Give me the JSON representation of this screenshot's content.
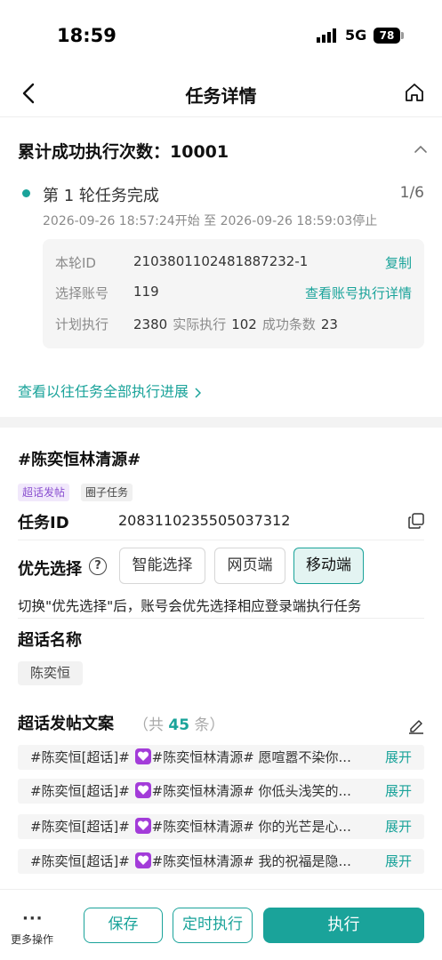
{
  "status_bar": {
    "time": "18:59",
    "network": "5G",
    "battery": "78"
  },
  "nav": {
    "title": "任务详情",
    "back_icon": "chevron-left-icon",
    "home_icon": "home-icon"
  },
  "summary": {
    "title": "累计成功执行次数：10001"
  },
  "round": {
    "title": "第 1 轮任务完成",
    "count": "1/6",
    "time_range": "2026-09-26 18:57:24开始 至 2026-09-26 18:59:03停止",
    "status_color": "#1aa39a"
  },
  "info": {
    "round_id_label": "本轮ID",
    "round_id": "2103801102481887232-1",
    "copy_link": "复制",
    "accounts_label": "选择账号",
    "accounts": "119",
    "accounts_link": "查看账号执行详情",
    "plan_label": "计划执行",
    "plan": "2380",
    "actual_label": "实际执行",
    "actual": "102",
    "success_label": "成功条数",
    "success": "23"
  },
  "history_link": "查看以往任务全部执行进展",
  "task": {
    "name": "#陈奕恒林清源#",
    "tags": [
      "超话发帖",
      "圈子任务"
    ],
    "id_label": "任务ID",
    "id": "2083110235505037312"
  },
  "priority": {
    "label": "优先选择",
    "help": "?",
    "options": [
      "智能选择",
      "网页端",
      "移动端"
    ],
    "selected": "移动端",
    "hint": "切换\"优先选择\"后，账号会优先选择相应登录端执行任务"
  },
  "topic": {
    "label": "超话名称",
    "value": "陈奕恒"
  },
  "copywriting": {
    "label": "超话发帖文案",
    "count_prefix": "（共",
    "count": "45",
    "count_suffix": "条）",
    "expand_label": "展开",
    "items": [
      {
        "prefix": "#陈奕恒[超话]# ",
        "rest": "#陈奕恒林清源# 愿喧嚣不染你..."
      },
      {
        "prefix": "#陈奕恒[超话]# ",
        "rest": "#陈奕恒林清源# 你低头浅笑的..."
      },
      {
        "prefix": "#陈奕恒[超话]# ",
        "rest": "#陈奕恒林清源# 你的光芒是心..."
      },
      {
        "prefix": "#陈奕恒[超话]# ",
        "rest": "#陈奕恒林清源# 我的祝福是隐..."
      }
    ]
  },
  "bottom": {
    "more_label": "更多操作",
    "save": "保存",
    "schedule": "定时执行",
    "execute": "执行"
  },
  "colors": {
    "accent": "#1aa39a",
    "tag_purple": "#8a4fd0",
    "heart": "#a33cd9"
  }
}
